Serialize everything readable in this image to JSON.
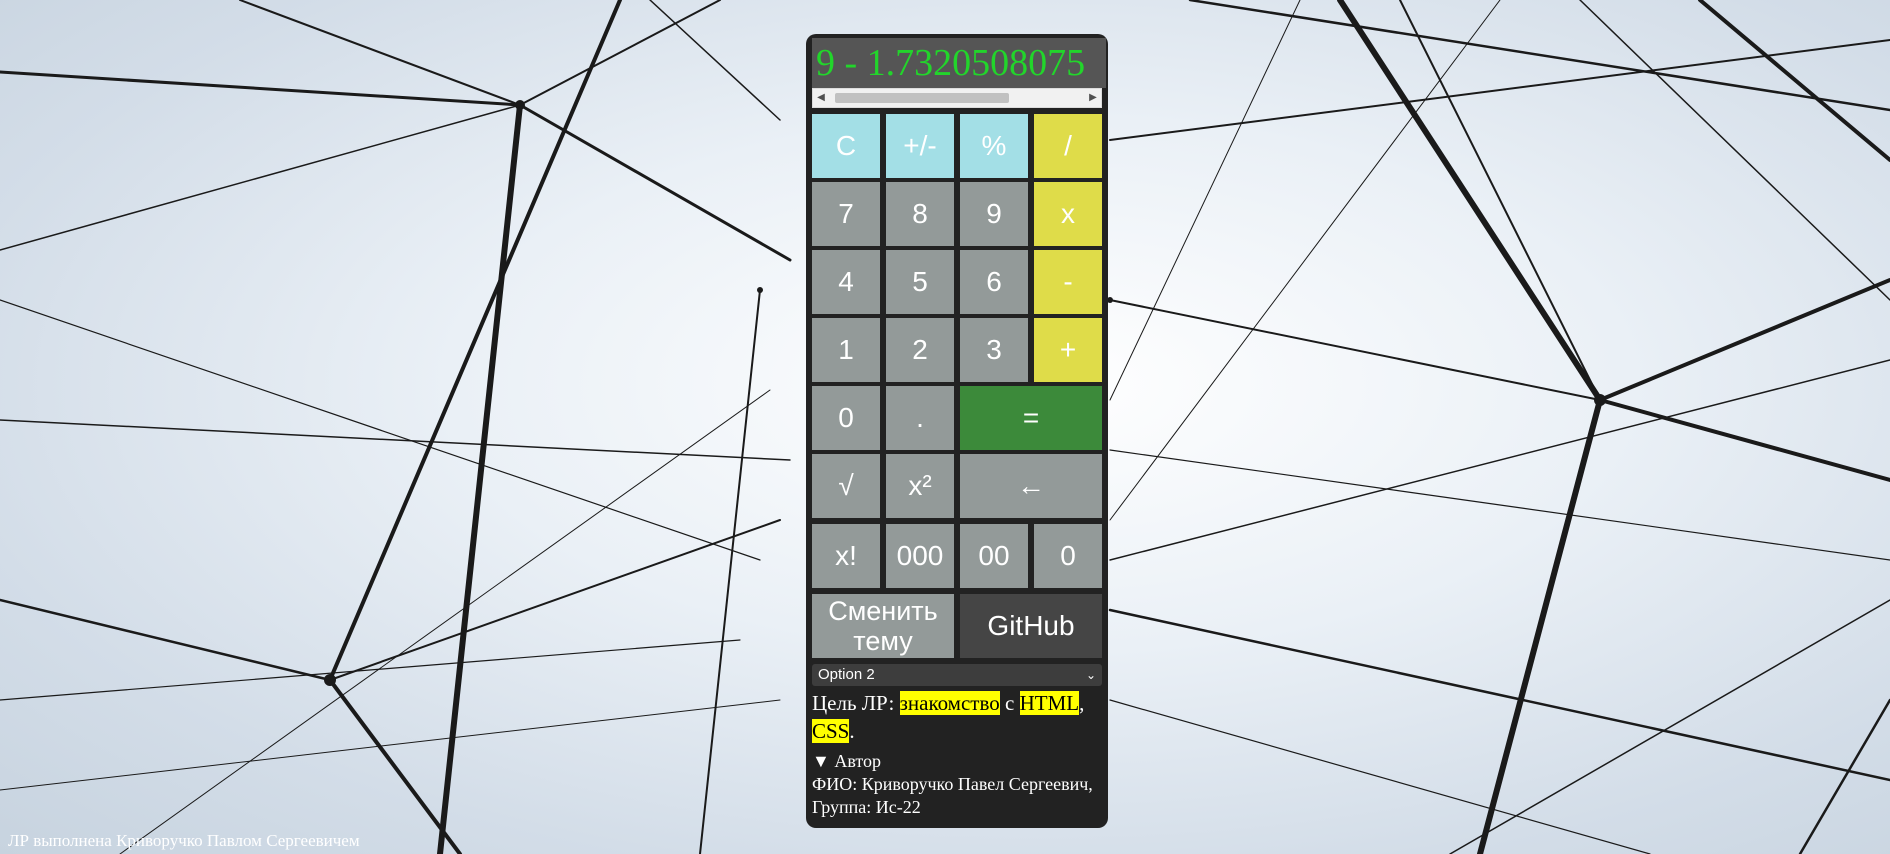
{
  "display": {
    "expression": "9 - 1.7320508075"
  },
  "scrollbar": {
    "left_arrow": "◀",
    "right_arrow": "▶"
  },
  "keys": {
    "clear": "C",
    "sign": "+/-",
    "percent": "%",
    "divide": "/",
    "seven": "7",
    "eight": "8",
    "nine": "9",
    "multiply": "x",
    "four": "4",
    "five": "5",
    "six": "6",
    "minus": "-",
    "one": "1",
    "two": "2",
    "three": "3",
    "plus": "+",
    "zero": "0",
    "dot": ".",
    "equals": "=",
    "sqrt": "√",
    "square": "x²",
    "backspace": "←",
    "factorial": "x!",
    "triple_zero": "000",
    "double_zero": "00",
    "zero2": "0",
    "theme": "Сменить тему",
    "github": "GitHub"
  },
  "select": {
    "value": "Option 2",
    "chevron": "⌄"
  },
  "goal": {
    "prefix": "Цель ЛР: ",
    "w1": "знакомство",
    "mid": " с ",
    "w2": "HTML",
    "comma": ", ",
    "w3": "CSS",
    "end": "."
  },
  "author": {
    "summary": "▼ Автор",
    "details": "ФИО: Криворучко Павел Сергеевич, Группа: Ис-22"
  },
  "footer": "ЛР выполнена Криворучко Павлом Сергеевичем",
  "colors": {
    "display_text": "#22d52b",
    "function_key": "#a3dfe6",
    "operator_key": "#dfdc49",
    "equals_key": "#3c8a3a",
    "number_key": "#939a99",
    "highlight": "#ffff00"
  }
}
